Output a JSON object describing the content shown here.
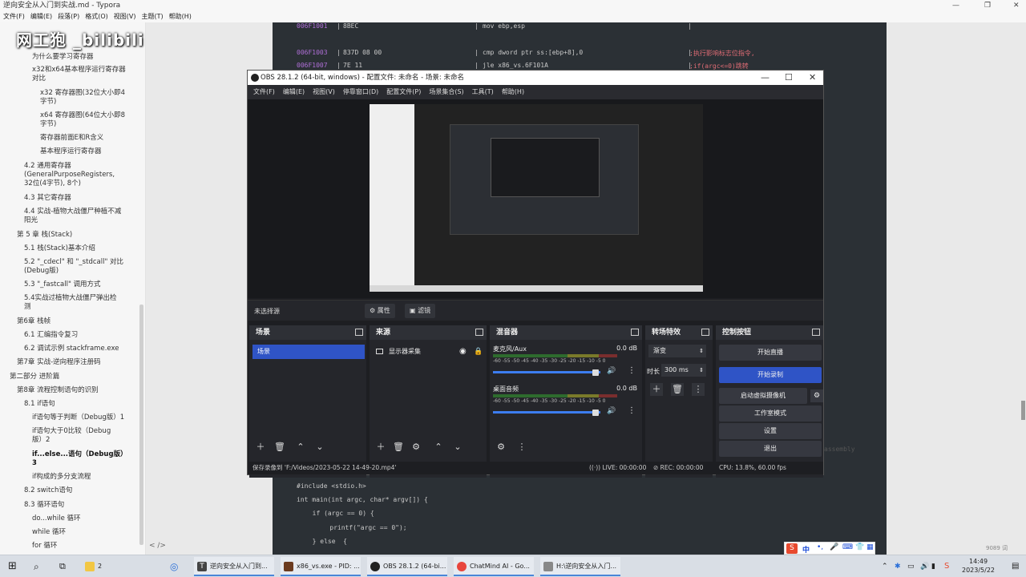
{
  "typora": {
    "title": "逆向安全从入门到实战.md - Typora",
    "menu": [
      "文件(F)",
      "编辑(E)",
      "段落(P)",
      "格式(O)",
      "视图(V)",
      "主题(T)",
      "帮助(H)"
    ],
    "toc": [
      {
        "text": "为什么要学习寄存器",
        "bold": false
      },
      {
        "text": "x32和x64基本程序运行寄存器",
        "bold": false
      },
      {
        "text": "对比",
        "bold": false
      },
      {
        "text": "x32 寄存器图(32位大小即4",
        "bold": false
      },
      {
        "text": "字节)",
        "bold": false
      },
      {
        "text": "x64 寄存器图(64位大小即8",
        "bold": false
      },
      {
        "text": "字节)",
        "bold": false
      },
      {
        "text": "寄存器前面E和R含义",
        "bold": false
      },
      {
        "text": "基本程序运行寄存器",
        "bold": false
      },
      {
        "text": "4.2 通用寄存器",
        "bold": false
      },
      {
        "text": "(GeneralPurposeRegisters,",
        "bold": false
      },
      {
        "text": "32位(4字节), 8个)",
        "bold": false
      },
      {
        "text": "4.3 其它寄存器",
        "bold": false
      },
      {
        "text": "4.4 实战-植物大战僵尸种植不减",
        "bold": false
      },
      {
        "text": "阳光",
        "bold": false
      },
      {
        "text": "第 5 章 栈(Stack)",
        "bold": false
      },
      {
        "text": "5.1 栈(Stack)基本介绍",
        "bold": false
      },
      {
        "text": "5.2 \"_cdecl\" 和 \"_stdcall\" 对比",
        "bold": false
      },
      {
        "text": "(Debug版)",
        "bold": false
      },
      {
        "text": "5.3 \"_fastcall\" 调用方式",
        "bold": false
      },
      {
        "text": "5.4实战过植物大战僵尸弹出检",
        "bold": false
      },
      {
        "text": "测",
        "bold": false
      },
      {
        "text": "第6章 栈帧",
        "bold": false
      },
      {
        "text": "6.1 汇编指令复习",
        "bold": false
      },
      {
        "text": "6.2 调试示例 stackframe.exe",
        "bold": false
      },
      {
        "text": "第7章 实战-逆向程序注册码",
        "bold": false
      },
      {
        "text": "第二部分 进阶篇",
        "bold": false
      },
      {
        "text": "第8章 流程控制语句的识别",
        "bold": false
      },
      {
        "text": "8.1 if语句",
        "bold": false
      },
      {
        "text": "if语句等于判断（Debug版）1",
        "bold": false
      },
      {
        "text": "if语句大于0比较（Debug",
        "bold": false
      },
      {
        "text": "版）2",
        "bold": false
      },
      {
        "text": "if...else...语句（Debug版）",
        "bold": true
      },
      {
        "text": "3",
        "bold": true
      },
      {
        "text": "if构成的多分支流程",
        "bold": false
      },
      {
        "text": "8.2 switch语句",
        "bold": false
      },
      {
        "text": "8.3 循环语句",
        "bold": false
      },
      {
        "text": "do...while 循环",
        "bold": false
      },
      {
        "text": "while 循环",
        "bold": false
      },
      {
        "text": "for 循环",
        "bold": false
      }
    ],
    "footer": "< />",
    "watermark": "网工狍 _bilibili",
    "assembly_label": "assembly",
    "word_count": "9089 词",
    "code_top": [
      {
        "addr": "006F1001",
        "bytes": "8BEC",
        "ins": "mov ebp,esp",
        "cmt": ""
      },
      {
        "addr": "006F1003",
        "bytes": "837D 08 00",
        "ins": "cmp dword ptr ss:[ebp+8],0",
        "cmt": ";执行影响标志位指令,"
      },
      {
        "addr": "006F1007",
        "bytes": "7E 11",
        "ins": "jle x86_vs.6F101A",
        "cmt": ";if(argc<=0)跳转"
      }
    ],
    "code_bottom": [
      "#include <stdio.h>",
      "int main(int argc, char* argv[]) {",
      "  if (argc == 0) {",
      "    printf(\"argc == 0\");",
      "  } else  {"
    ]
  },
  "obs": {
    "title": "OBS 28.1.2 (64-bit, windows) - 配置文件: 未命名 - 场景: 未命名",
    "menu": [
      "文件(F)",
      "编辑(E)",
      "视图(V)",
      "停靠窗口(D)",
      "配置文件(P)",
      "场景集合(S)",
      "工具(T)",
      "帮助(H)"
    ],
    "no_source": "未选择源",
    "properties": "属性",
    "filters": "滤镜",
    "docks": {
      "scenes": {
        "title": "场景",
        "items": [
          "场景"
        ]
      },
      "sources": {
        "title": "来源",
        "items": [
          "显示器采集"
        ]
      },
      "mixer": {
        "title": "混音器",
        "tracks": [
          {
            "name": "麦克风/Aux",
            "db": "0.0 dB",
            "level": 0.85
          },
          {
            "name": "桌面音频",
            "db": "0.0 dB",
            "level": 0.85
          }
        ],
        "scale": "-60 -55 -50 -45 -40 -35 -30 -25 -20 -15 -10 -5 0"
      },
      "transitions": {
        "title": "转场特效",
        "type": "渐变",
        "duration_label": "时长",
        "duration": "300 ms"
      },
      "controls": {
        "title": "控制按钮",
        "buttons": [
          "开始直播",
          "开始录制",
          "启动虚拟摄像机",
          "工作室模式",
          "设置",
          "退出"
        ]
      }
    },
    "status": {
      "recording_path": "保存录像到 'F:/Videos/2023-05-22 14-49-20.mp4'",
      "live": "LIVE: 00:00:00",
      "rec": "REC: 00:00:00",
      "cpu": "CPU: 13.8%, 60.00 fps"
    }
  },
  "taskbar": {
    "explorer_count": "2",
    "apps": [
      "逆向安全从入门到...",
      "x86_vs.exe - PID: ...",
      "OBS 28.1.2 (64-bi...",
      "ChatMind AI - Go...",
      "H:\\逆向安全从入门..."
    ],
    "time": "14:49",
    "date": "2023/5/22",
    "ime_char": "中"
  }
}
